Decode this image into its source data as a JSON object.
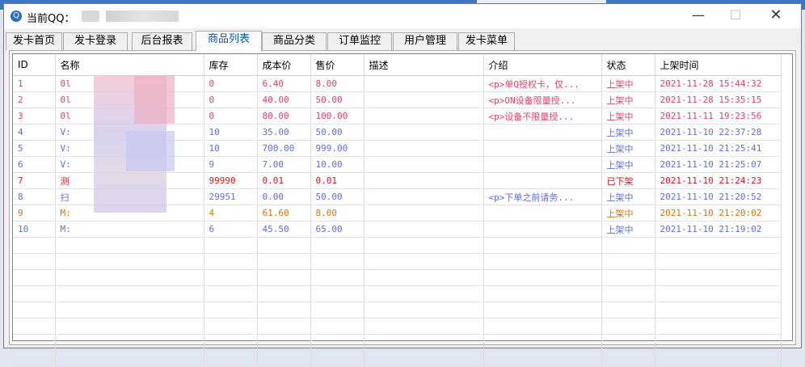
{
  "window": {
    "title": "当前QQ：",
    "minimize_icon": "minimize-icon",
    "maximize_icon": "maximize-icon",
    "close_icon": "close-icon"
  },
  "tabs": [
    {
      "label": "发卡首页"
    },
    {
      "label": "发卡登录"
    },
    {
      "label": "后台报表"
    },
    {
      "label": "商品列表",
      "active": true
    },
    {
      "label": "商品分类"
    },
    {
      "label": "订单监控"
    },
    {
      "label": "用户管理"
    },
    {
      "label": "发卡菜单"
    }
  ],
  "table": {
    "columns": [
      "ID",
      "名称",
      "库存",
      "成本价",
      "售价",
      "描述",
      "介绍",
      "状态",
      "上架时间"
    ],
    "rows": [
      {
        "id": "1",
        "name": "0l",
        "stock": "0",
        "cost": "6.40",
        "price": "8.00",
        "desc": "",
        "intro": "<p>单Q授权卡，仅...",
        "status": "上架中",
        "time": "2021-11-28 15:44:32",
        "color": "#e0406c"
      },
      {
        "id": "2",
        "name": "0l",
        "stock": "0",
        "cost": "40.00",
        "price": "50.00",
        "desc": "",
        "intro": "<p>ON设备限量授...",
        "status": "上架中",
        "time": "2021-11-28 15:35:15",
        "color": "#e0406c"
      },
      {
        "id": "3",
        "name": "0l",
        "stock": "0",
        "cost": "80.00",
        "price": "100.00",
        "desc": "",
        "intro": "<p>设备不限量授...",
        "status": "上架中",
        "time": "2021-11-11 19:23:56",
        "color": "#e0406c"
      },
      {
        "id": "4",
        "name": "V:",
        "stock": "10",
        "cost": "35.00",
        "price": "50.00",
        "desc": "",
        "intro": "",
        "status": "上架中",
        "time": "2021-11-10 22:37:28",
        "color": "#5f6ed8"
      },
      {
        "id": "5",
        "name": "V:",
        "stock": "10",
        "cost": "700.00",
        "price": "999.00",
        "desc": "",
        "intro": "",
        "status": "上架中",
        "time": "2021-11-10 21:25:41",
        "color": "#5f6ed8"
      },
      {
        "id": "6",
        "name": "V:",
        "stock": "9",
        "cost": "7.00",
        "price": "10.00",
        "desc": "",
        "intro": "",
        "status": "上架中",
        "time": "2021-11-10 21:25:07",
        "color": "#5f6ed8"
      },
      {
        "id": "7",
        "name": "测",
        "stock": "99990",
        "cost": "0.01",
        "price": "0.01",
        "desc": "",
        "intro": "",
        "status": "已下架",
        "time": "2021-11-10 21:24:23",
        "color": "#e3101c"
      },
      {
        "id": "8",
        "name": "扫",
        "stock": "29951",
        "cost": "0.00",
        "price": "50.00",
        "desc": "",
        "intro": "<p>下单之前请务...",
        "status": "上架中",
        "time": "2021-11-10 21:20:52",
        "color": "#5f6ed8"
      },
      {
        "id": "9",
        "name": "M:",
        "stock": "4",
        "cost": "61.60",
        "price": "8.00",
        "desc": "",
        "intro": "",
        "status": "上架中",
        "time": "2021-11-10 21:20:02",
        "color": "#c8780e"
      },
      {
        "id": "10",
        "name": "M:",
        "stock": "6",
        "cost": "45.50",
        "price": "65.00",
        "desc": "",
        "intro": "",
        "status": "上架中",
        "time": "2021-11-10 21:19:02",
        "color": "#5f6ed8"
      }
    ]
  }
}
